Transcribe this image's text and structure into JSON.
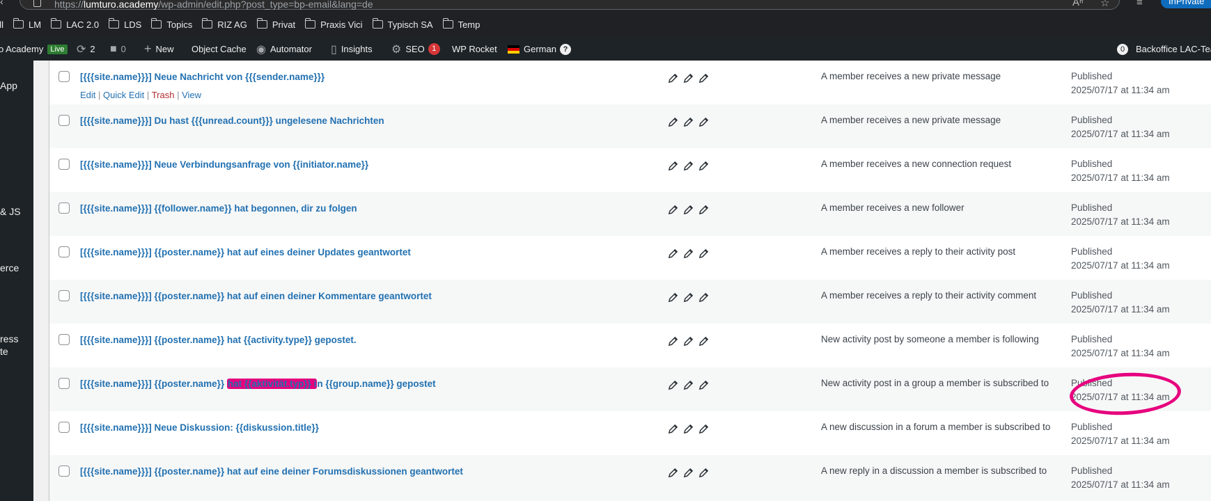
{
  "browser": {
    "url_prefix": "https://",
    "url_domain": "lumturo.academy",
    "url_path": "/wp-admin/edit.php?post_type=bp-email&lang=de",
    "inprivate_label": "InPrivate",
    "bookmarks": [
      {
        "label": "ell",
        "folder": false
      },
      {
        "label": "LM",
        "folder": true
      },
      {
        "label": "LAC 2.0",
        "folder": true
      },
      {
        "label": "LDS",
        "folder": true
      },
      {
        "label": "Topics",
        "folder": true
      },
      {
        "label": "RIZ AG",
        "folder": true
      },
      {
        "label": "Privat",
        "folder": true
      },
      {
        "label": "Praxis Vici",
        "folder": true
      },
      {
        "label": "Typisch SA",
        "folder": true
      },
      {
        "label": "Temp",
        "folder": true
      }
    ]
  },
  "adminbar": {
    "site_name": "o Academy",
    "live_label": "Live",
    "updates_count": "2",
    "comments_count": "0",
    "new_label": "New",
    "object_cache_label": "Object Cache",
    "automator_label": "Automator",
    "insights_label": "Insights",
    "seo_label": "SEO",
    "seo_count": "1",
    "wp_rocket_label": "WP Rocket",
    "language_label": "German",
    "language_help": "?",
    "notifications_count": "0",
    "account_label": "Backoffice LAC-Tea"
  },
  "sidebar": {
    "items": [
      "App",
      "& JS",
      "erce",
      "ress",
      "te"
    ]
  },
  "row_actions": {
    "edit": "Edit",
    "quick_edit": "Quick Edit",
    "trash": "Trash",
    "view": "View",
    "separator": "|"
  },
  "rows": [
    {
      "title": "[{{{site.name}}}] Neue Nachricht von {{{sender.name}}}",
      "situation": "A member receives a new private message",
      "status": "Published",
      "date": "2025/07/17 at 11:34 am"
    },
    {
      "title": "[{{{site.name}}}] Du hast {{{unread.count}}} ungelesene Nachrichten",
      "situation": "A member receives a new private message",
      "status": "Published",
      "date": "2025/07/17 at 11:34 am"
    },
    {
      "title": "[{{{site.name}}}] Neue Verbindungsanfrage von {{initiator.name}}",
      "situation": "A member receives a new connection request",
      "status": "Published",
      "date": "2025/07/17 at 11:34 am"
    },
    {
      "title": "[{{{site.name}}}] {{follower.name}} hat begonnen, dir zu folgen",
      "situation": "A member receives a new follower",
      "status": "Published",
      "date": "2025/07/17 at 11:34 am"
    },
    {
      "title": "[{{{site.name}}}] {{poster.name}} hat auf eines deiner Updates geantwortet",
      "situation": "A member receives a reply to their activity post",
      "status": "Published",
      "date": "2025/07/17 at 11:34 am"
    },
    {
      "title": "[{{{site.name}}}] {{poster.name}} hat auf einen deiner Kommentare geantwortet",
      "situation": "A member receives a reply to their activity comment",
      "status": "Published",
      "date": "2025/07/17 at 11:34 am"
    },
    {
      "title": "[{{{site.name}}}] {{poster.name}} hat {{activity.type}} gepostet.",
      "situation": "New activity post by someone a member is following",
      "status": "Published",
      "date": "2025/07/17 at 11:34 am"
    },
    {
      "title_before": "[{{{site.name}}}] {{poster.name}} ",
      "title_highlight": "hat {{aktivität.typ}} i",
      "title_after": "n {{group.name}} gepostet",
      "situation": "New activity post in a group a member is subscribed to",
      "status": "Published",
      "date": "2025/07/17 at 11:34 am"
    },
    {
      "title": "[{{{site.name}}}] Neue Diskussion: {{diskussion.title}}",
      "situation": "A new discussion in a forum a member is subscribed to",
      "status": "Published",
      "date": "2025/07/17 at 11:34 am"
    },
    {
      "title": "[{{{site.name}}}] {{poster.name}} hat auf eine deiner Forumsdiskussionen geantwortet",
      "situation": "A new reply in a discussion a member is subscribed to",
      "status": "Published",
      "date": "2025/07/17 at 11:34 am"
    }
  ],
  "colors": {
    "link": "#2271b1",
    "trash": "#b32d2e",
    "highlight": "#e6007e",
    "adminbar_bg": "#1d2327"
  }
}
